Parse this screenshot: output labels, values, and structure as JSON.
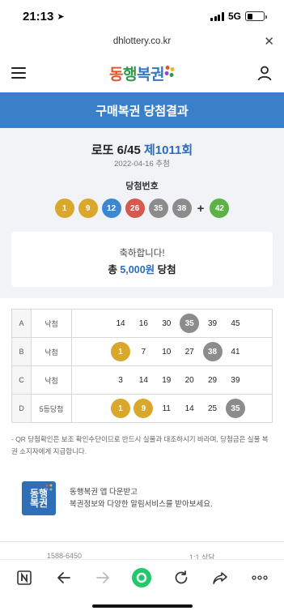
{
  "status_bar": {
    "time": "21:13",
    "network": "5G"
  },
  "browser": {
    "url": "dhlottery.co.kr"
  },
  "header": {
    "logo_text_1": "동",
    "logo_text_2": "행",
    "logo_text_3": "복권"
  },
  "banner": {
    "title": "구매복권 당첨결과"
  },
  "draw": {
    "game": "로또 6/45",
    "round": "제1011회",
    "date": "2022-04-16 추첨",
    "winning_label": "당첨번호",
    "numbers": [
      {
        "n": "1",
        "color": "#d9a72c"
      },
      {
        "n": "9",
        "color": "#d9a72c"
      },
      {
        "n": "12",
        "color": "#3f86d1"
      },
      {
        "n": "26",
        "color": "#d8584f"
      },
      {
        "n": "35",
        "color": "#8c8c8c"
      },
      {
        "n": "38",
        "color": "#8c8c8c"
      }
    ],
    "plus": "+",
    "bonus": {
      "n": "42",
      "color": "#5db246"
    }
  },
  "result": {
    "line1": "축하합니다!",
    "prefix": "총",
    "amount": "5,000원",
    "suffix": "당첨"
  },
  "tickets": [
    {
      "game": "A",
      "rank": "낙첨",
      "numbers": [
        "14",
        "16",
        "30",
        "35",
        "39",
        "45"
      ],
      "matched": [
        "35"
      ]
    },
    {
      "game": "B",
      "rank": "낙첨",
      "numbers": [
        "1",
        "7",
        "10",
        "27",
        "38",
        "41"
      ],
      "matched": [
        "1",
        "38"
      ]
    },
    {
      "game": "C",
      "rank": "낙첨",
      "numbers": [
        "3",
        "14",
        "19",
        "20",
        "29",
        "39"
      ],
      "matched": []
    },
    {
      "game": "D",
      "rank": "5등당첨",
      "numbers": [
        "1",
        "9",
        "11",
        "14",
        "25",
        "35"
      ],
      "matched": [
        "1",
        "9",
        "35"
      ]
    }
  ],
  "notice": "- QR 당첨확인은 보조 확인수단이므로 반드시 실물과 대조하시기 바라며, 당첨금은 실물 복권 소지자에게 지급합니다.",
  "app_promo": {
    "icon_line1": "동행",
    "icon_line2": "복권",
    "line1": "동행복권 앱 다운받고",
    "line2": "복권정보와 다양한 알림서비스를 받아보세요."
  },
  "peek": {
    "left": "1588-6450",
    "right": "1:1 상담"
  },
  "icons": [
    "navigation-arrow-icon",
    "signal-icon",
    "battery-icon",
    "close-icon",
    "hamburger-icon",
    "user-icon",
    "naver-icon",
    "back-icon",
    "forward-icon",
    "home-icon",
    "reload-icon",
    "share-icon",
    "more-icon"
  ]
}
